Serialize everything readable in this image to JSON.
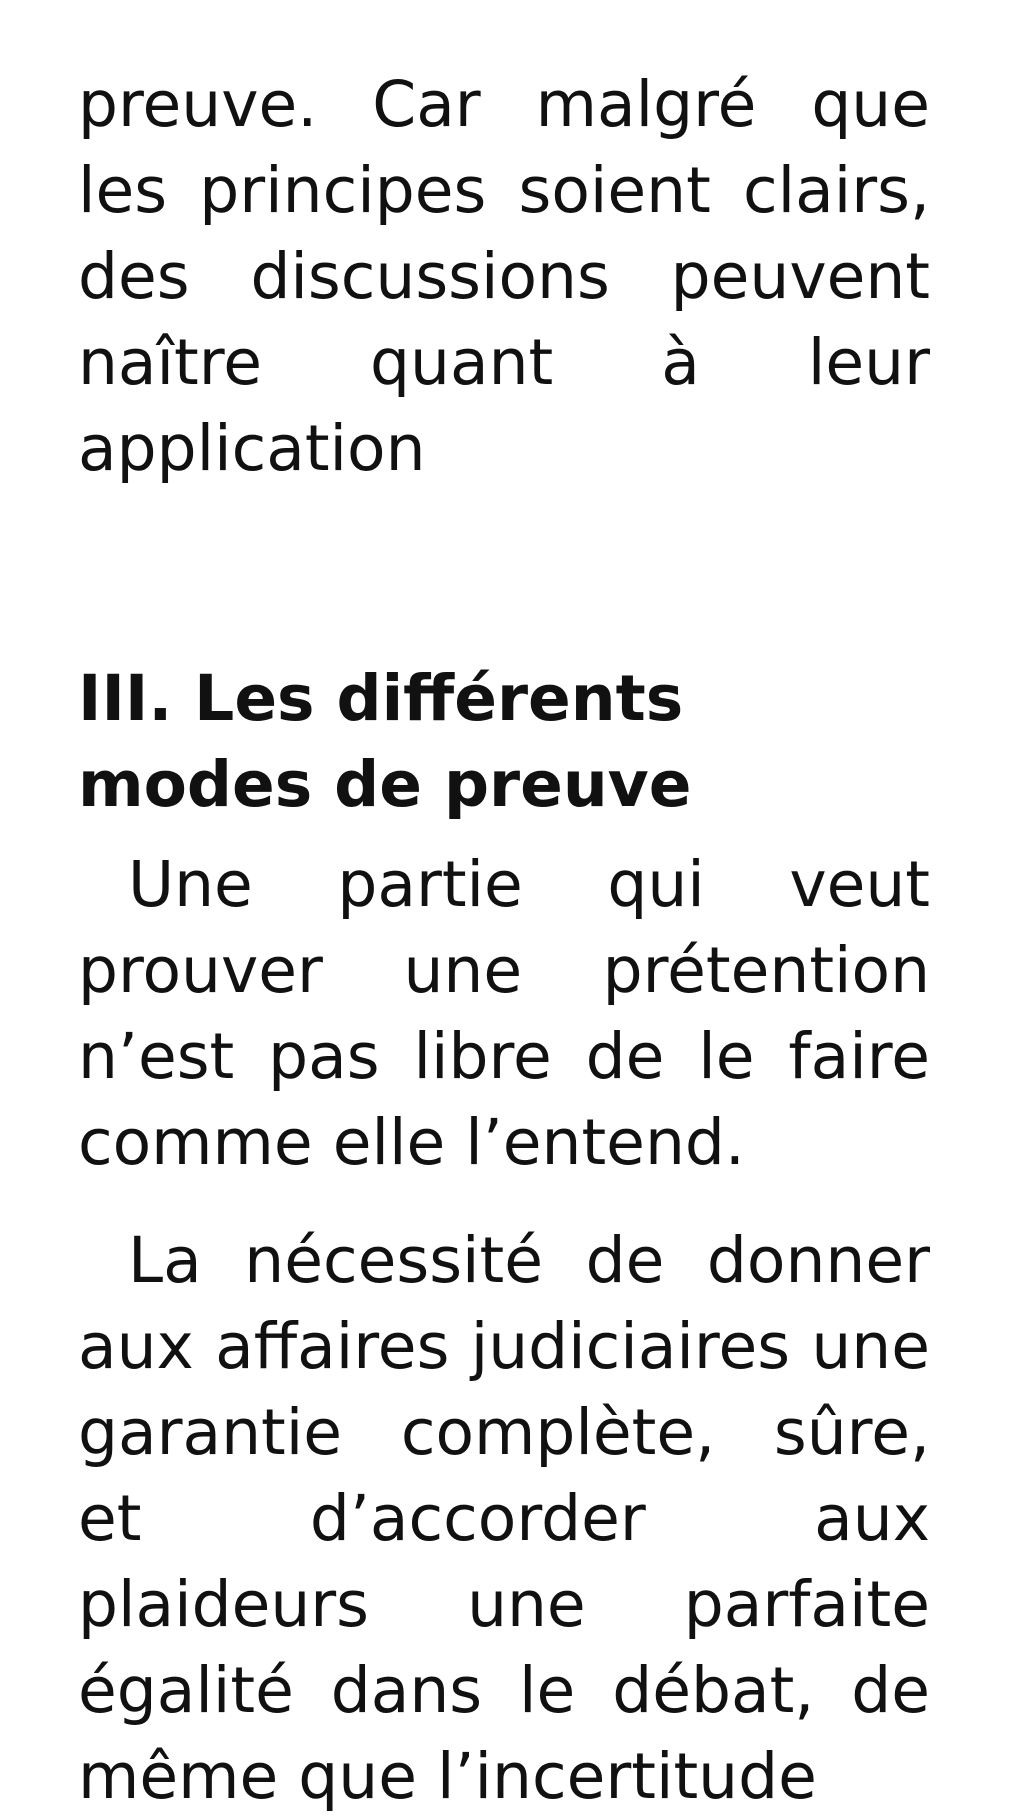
{
  "document": {
    "intro_continuation": "preuve. Car malgré que les principes soient clairs, des discussions peuvent naître quant à leur application",
    "section_heading": "III. Les différents modes de preuve",
    "paragraphs": [
      "Une partie qui veut prouver une prétention n’est pas libre de le faire comme elle l’entend.",
      "La nécessité de donner aux affaires judiciaires une garantie complète, sûre, et d’accorder aux plaideurs une parfaite égalité dans le débat, de même que l’incertitude"
    ]
  }
}
